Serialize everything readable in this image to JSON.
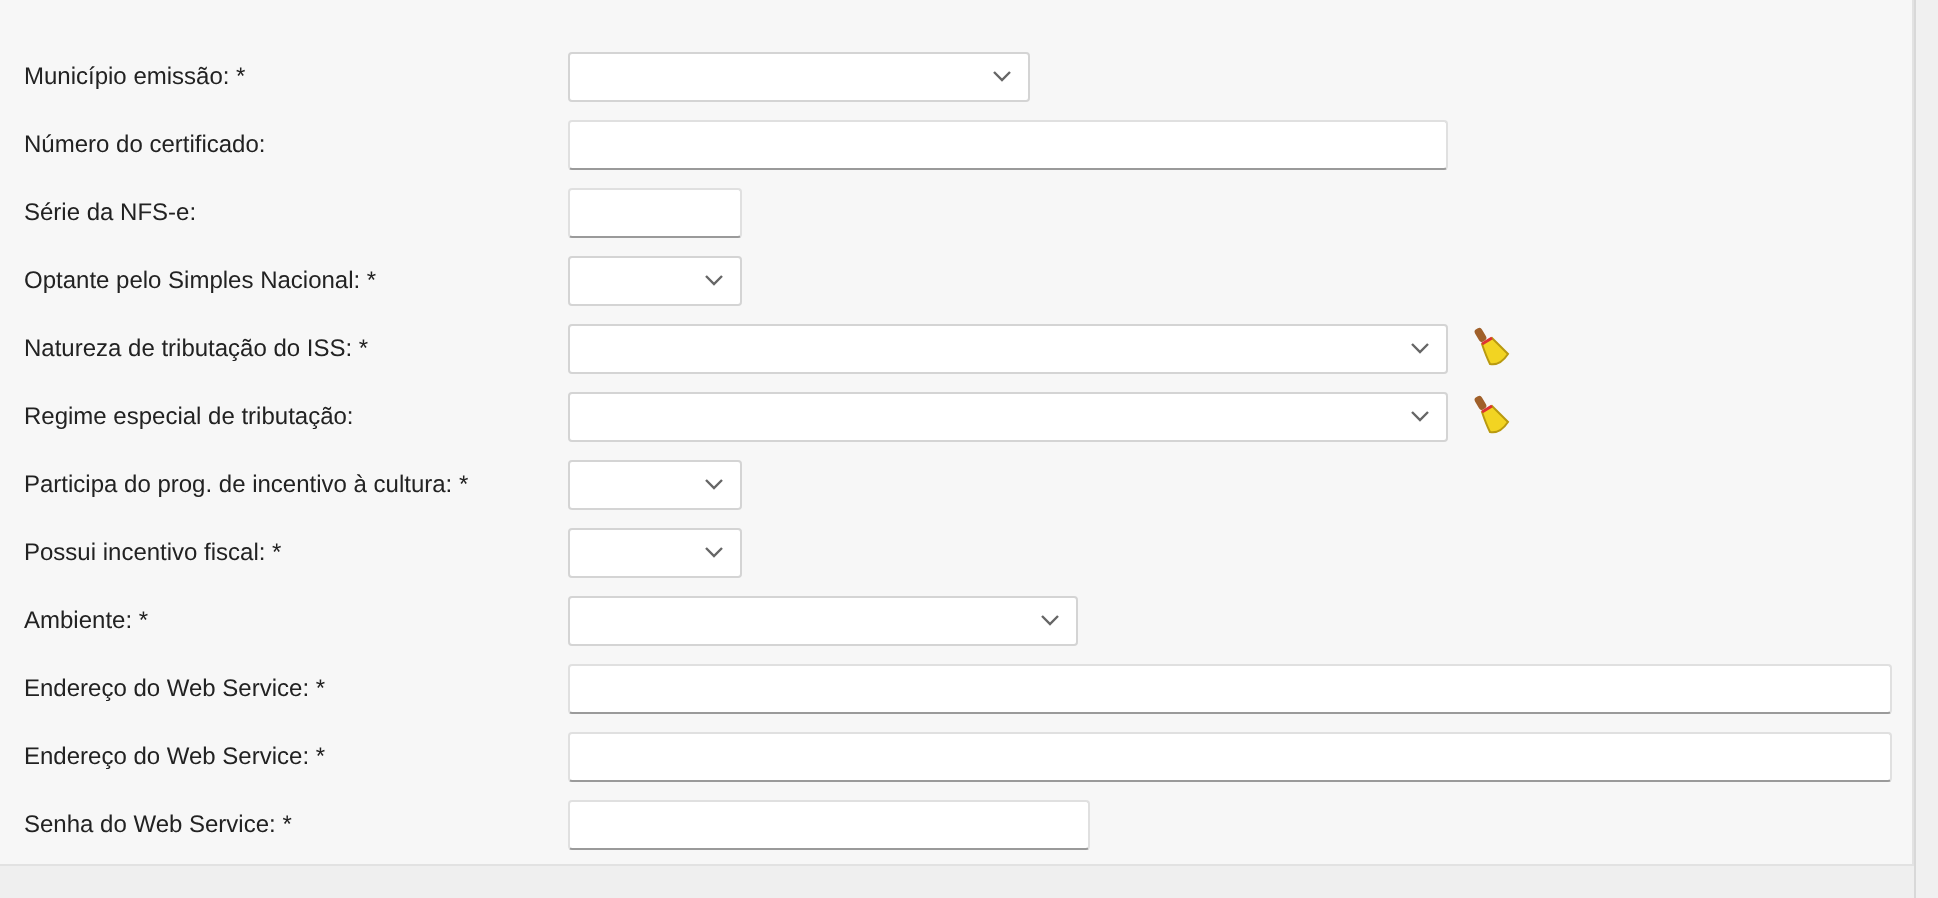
{
  "fields": [
    {
      "label": "Município emissão: *",
      "kind": "select",
      "clearable": false
    },
    {
      "label": "Número do certificado:",
      "kind": "text",
      "clearable": false
    },
    {
      "label": "Série da NFS-e:",
      "kind": "text",
      "clearable": false
    },
    {
      "label": "Optante pelo Simples Nacional: *",
      "kind": "select",
      "clearable": false
    },
    {
      "label": "Natureza de tributação do ISS: *",
      "kind": "select",
      "clearable": true
    },
    {
      "label": "Regime especial de tributação:",
      "kind": "select",
      "clearable": true
    },
    {
      "label": "Participa do prog. de incentivo à cultura: *",
      "kind": "select",
      "clearable": false
    },
    {
      "label": "Possui incentivo fiscal: *",
      "kind": "select",
      "clearable": false
    },
    {
      "label": "Ambiente: *",
      "kind": "select",
      "clearable": false
    },
    {
      "label": "Endereço do Web Service: *",
      "kind": "text",
      "clearable": false
    },
    {
      "label": "Endereço do Web Service: *",
      "kind": "text",
      "clearable": false
    },
    {
      "label": "Senha do Web Service: *",
      "kind": "text",
      "clearable": false
    }
  ]
}
